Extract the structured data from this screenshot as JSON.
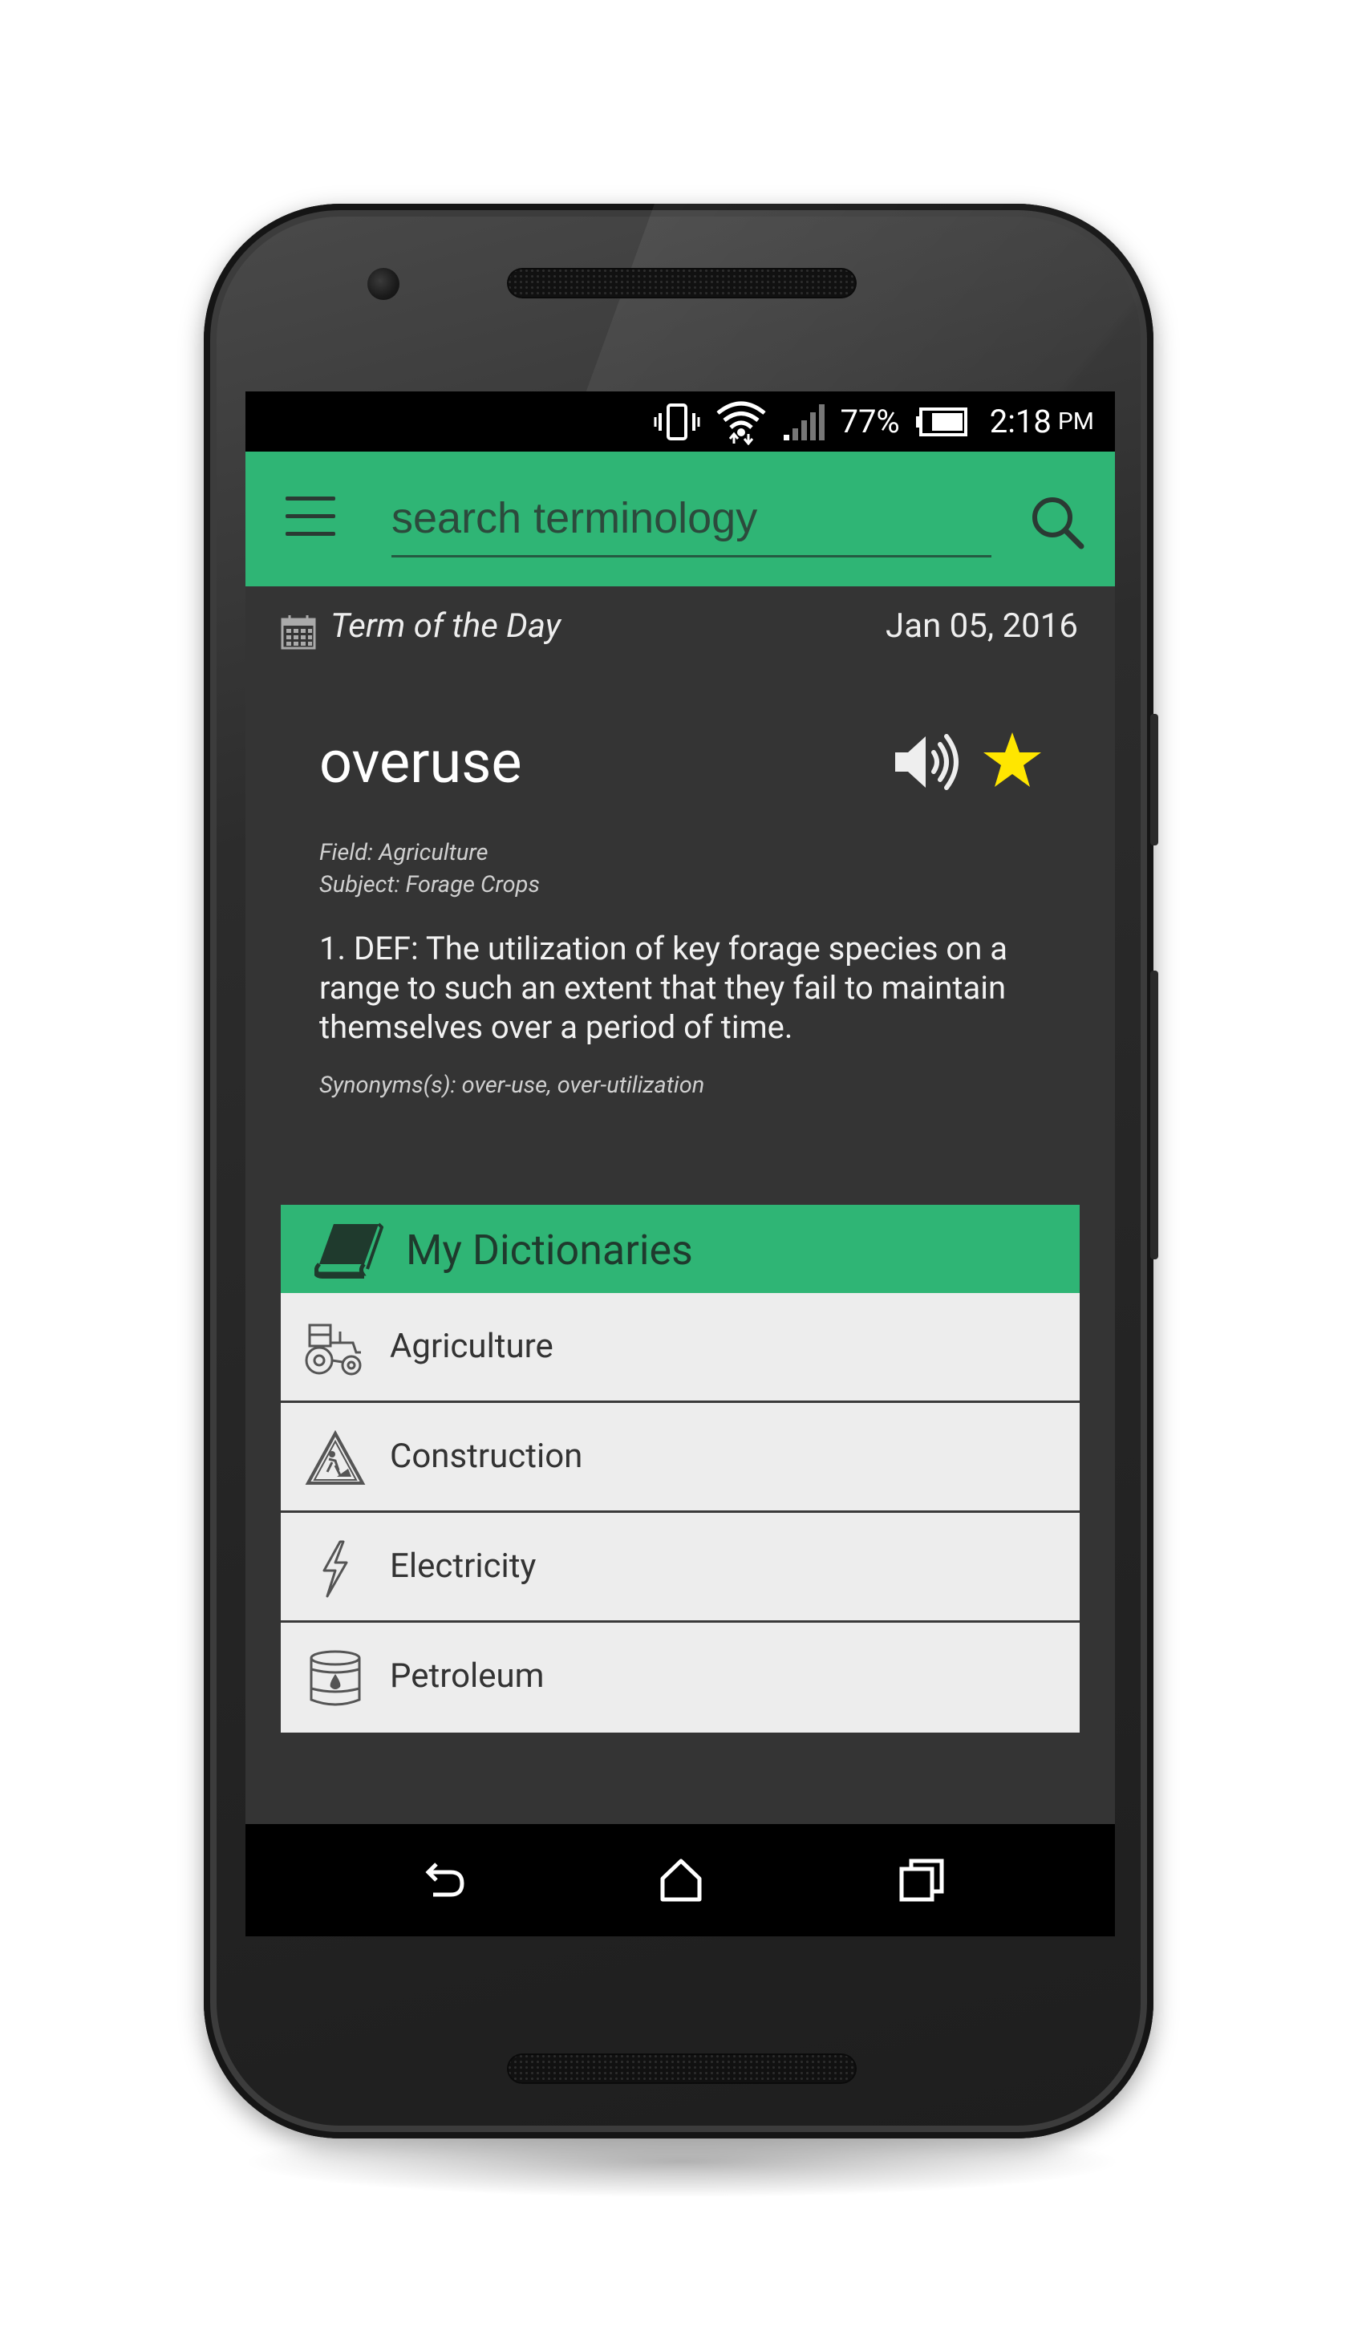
{
  "status_bar": {
    "battery": "77%",
    "time": "2:18",
    "ampm": "PM",
    "icons": [
      "vibrate-icon",
      "wifi-icon",
      "signal-icon",
      "battery-icon"
    ]
  },
  "toolbar": {
    "search_placeholder": "search terminology",
    "menu_icon": "hamburger-menu-icon",
    "search_icon": "search-icon"
  },
  "term_of_day": {
    "label": "Term of the Day",
    "date": "Jan 05, 2016",
    "term": "overuse",
    "field": "Field: Agriculture",
    "subject": "Subject: Forage Crops",
    "definition": "1.   DEF: The utilization of key forage species on a range to such an extent that they fail to maintain themselves over a period of time.",
    "synonyms": "Synonyms(s): over-use, over-utilization",
    "favorite": true,
    "accent_star": "#ffe600"
  },
  "dictionaries": {
    "title": "My Dictionaries",
    "items": [
      {
        "label": "Agriculture",
        "icon": "tractor-icon"
      },
      {
        "label": "Construction",
        "icon": "construction-sign-icon"
      },
      {
        "label": "Electricity",
        "icon": "lightning-bolt-icon"
      },
      {
        "label": "Petroleum",
        "icon": "oil-barrel-icon"
      }
    ]
  },
  "nav_bar": {
    "buttons": [
      "back-icon",
      "home-icon",
      "recents-icon"
    ]
  },
  "colors": {
    "accent": "#2fb575",
    "screen_bg": "#343434",
    "list_bg": "#ededed"
  }
}
